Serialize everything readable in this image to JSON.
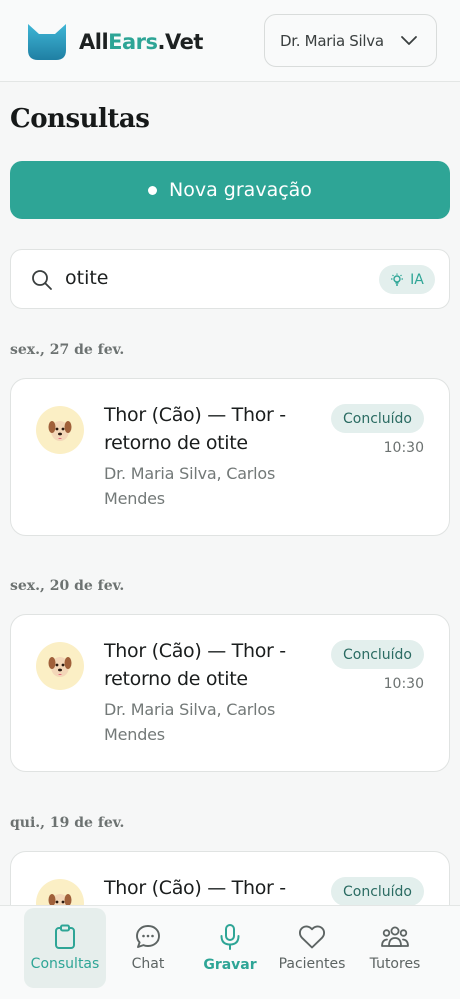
{
  "header": {
    "logo_part1": "All",
    "logo_part2": "Ears",
    "logo_part3": ".Vet",
    "user_name": "Dr. Maria Silva",
    "user_chevron_icon": "chevron-down-icon"
  },
  "page": {
    "title": "Consultas",
    "new_recording_label": "Nova gravação"
  },
  "search": {
    "value": "otite",
    "icon": "search-icon",
    "ai_badge": "IA"
  },
  "groups": [
    {
      "date": "sex., 27 de fev.",
      "consultation": {
        "title": "Thor (Cão) — Thor - retorno de otite",
        "people": "Dr. Maria Silva, Carlos Mendes",
        "status": "Concluído",
        "time": "10:30",
        "avatar_icon": "dog-icon"
      }
    },
    {
      "date": "sex., 20 de fev.",
      "consultation": {
        "title": "Thor (Cão) — Thor - retorno de otite",
        "people": "Dr. Maria Silva, Carlos Mendes",
        "status": "Concluído",
        "time": "10:30",
        "avatar_icon": "dog-icon"
      }
    },
    {
      "date": "qui., 19 de fev.",
      "consultation": {
        "title": "Thor (Cão) — Thor -",
        "status": "Concluído",
        "avatar_icon": "dog-icon"
      }
    }
  ],
  "tabs": [
    {
      "label": "Consultas",
      "icon": "clipboard-icon",
      "active": true
    },
    {
      "label": "Chat",
      "icon": "chat-bubble-icon"
    },
    {
      "label": "Gravar",
      "icon": "microphone-icon"
    },
    {
      "label": "Pacientes",
      "icon": "heart-icon"
    },
    {
      "label": "Tutores",
      "icon": "people-icon"
    }
  ],
  "colors": {
    "accent": "#2ea596",
    "status_bg": "#e3efed",
    "avatar_bg": "#fbefc5"
  }
}
